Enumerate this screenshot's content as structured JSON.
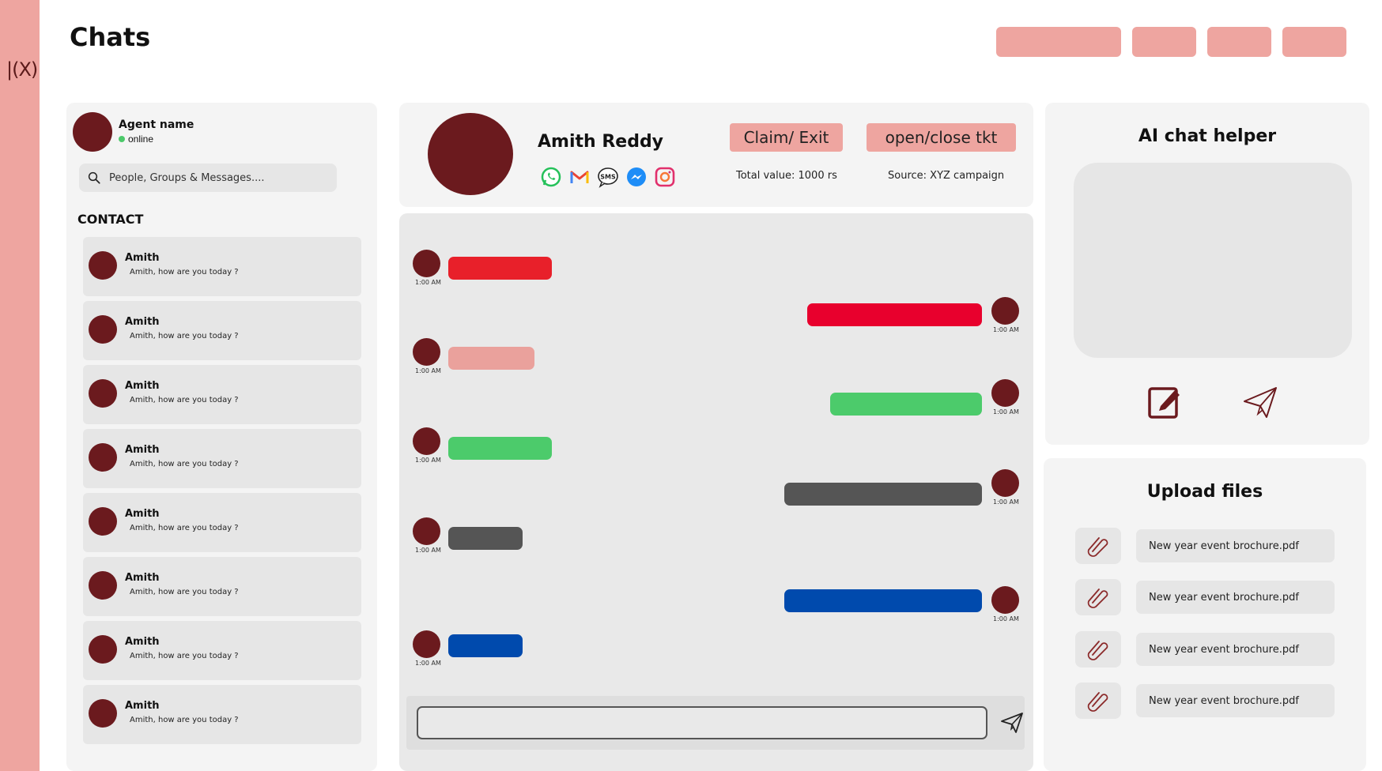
{
  "app": {
    "logo_text": "|(X)",
    "page_title": "Chats"
  },
  "top_buttons": [
    "",
    "",
    "",
    ""
  ],
  "agent": {
    "name": "Agent name",
    "status": "online"
  },
  "search": {
    "placeholder": "People, Groups & Messages...."
  },
  "contacts": {
    "heading": "CONTACT",
    "items": [
      {
        "name": "Amith",
        "message": "Amith, how are you today  ?"
      },
      {
        "name": "Amith",
        "message": "Amith, how are you today  ?"
      },
      {
        "name": "Amith",
        "message": "Amith, how are you today  ?"
      },
      {
        "name": "Amith",
        "message": "Amith, how are you today  ?"
      },
      {
        "name": "Amith",
        "message": "Amith, how are you today  ?"
      },
      {
        "name": "Amith",
        "message": "Amith, how are you today  ?"
      },
      {
        "name": "Amith",
        "message": "Amith, how are you today  ?"
      },
      {
        "name": "Amith",
        "message": "Amith, how are you today  ?"
      }
    ]
  },
  "chat_header": {
    "customer_name": "Amith Reddy",
    "channels": [
      "whatsapp-icon",
      "gmail-icon",
      "sms-icon",
      "messenger-icon",
      "instagram-icon"
    ],
    "claim_button": "Claim/ Exit",
    "ticket_button": "open/close tkt",
    "total_value": "Total value: 1000 rs",
    "source": "Source: XYZ campaign"
  },
  "messages": [
    {
      "side": "left",
      "time": "1:00 AM",
      "color": "#e8202a"
    },
    {
      "side": "right",
      "time": "1:00 AM",
      "color": "#e8002d"
    },
    {
      "side": "left",
      "time": "1:00 AM",
      "color": "#eaa19c"
    },
    {
      "side": "right",
      "time": "1:00 AM",
      "color": "#4ccb6b"
    },
    {
      "side": "left",
      "time": "1:00 AM",
      "color": "#4ccb6b"
    },
    {
      "side": "right",
      "time": "1:00 AM",
      "color": "#555555"
    },
    {
      "side": "left",
      "time": "1:00 AM",
      "color": "#555555"
    },
    {
      "side": "right",
      "time": "1:00 AM",
      "color": "#004aad"
    },
    {
      "side": "left",
      "time": "1:00 AM",
      "color": "#004aad"
    }
  ],
  "ai_helper": {
    "title": "AI chat helper"
  },
  "upload": {
    "title": "Upload files",
    "files": [
      "New year event brochure.pdf",
      "New year event brochure.pdf",
      "New year event brochure.pdf",
      "New year event brochure.pdf"
    ]
  },
  "colors": {
    "accent": "#eea5a0",
    "avatar": "#6b1a1e",
    "panel": "#f4f4f4"
  }
}
